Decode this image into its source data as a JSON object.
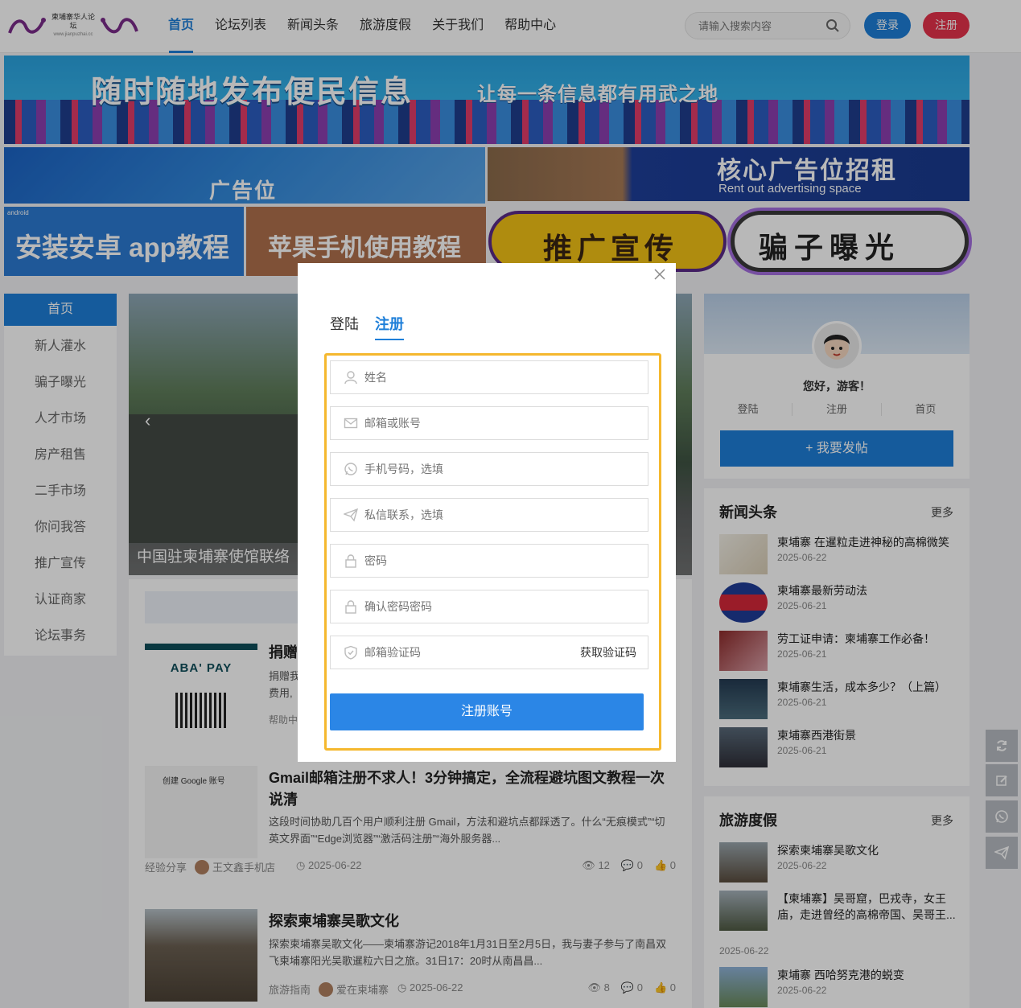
{
  "header": {
    "logo_text": "柬埔寨华人论坛",
    "logo_url": "www.jianpuzhai.cc",
    "nav": [
      "首页",
      "论坛列表",
      "新闻头条",
      "旅游度假",
      "关于我们",
      "帮助中心"
    ],
    "search_placeholder": "请输入搜索内容",
    "login": "登录",
    "register": "注册"
  },
  "banners": {
    "main_title": "随时随地发布便民信息",
    "main_sub": "让每一条信息都有用武之地",
    "ad1": "广告位",
    "ad2_title": "核心广告位招租",
    "ad2_sub": "Rent out advertising space",
    "small": [
      "安装安卓 app教程",
      "苹果手机使用教程",
      "推广宣传",
      "骗子曝光"
    ],
    "android_tag": "android"
  },
  "sidebar": {
    "items": [
      "首页",
      "新人灌水",
      "骗子曝光",
      "人才市场",
      "房产租售",
      "二手市场",
      "你问我答",
      "推广宣传",
      "认证商家",
      "论坛事务"
    ]
  },
  "slider": {
    "caption": "中国驻柬埔寨使馆联络"
  },
  "articles": [
    {
      "title": "捐赠",
      "desc": "捐赠我\n费用,",
      "category": "帮助中",
      "thumb_brand": "ABA' PAY"
    },
    {
      "title": "Gmail邮箱注册不求人！3分钟搞定，全流程避坑图文教程一次说清",
      "desc": "这段时间协助几百个用户顺利注册 Gmail，方法和避坑点都踩透了。什么“无痕模式”“切英文界面”“Edge浏览器”“激活码注册”“海外服务器...",
      "category": "经验分享",
      "author": "王文鑫手机店",
      "date": "2025-06-22",
      "views": "12",
      "comments": "0",
      "likes": "0",
      "thumb_text": "创建 Google 账号"
    },
    {
      "title": "探索柬埔寨吴歌文化",
      "desc": "探索柬埔寨吴歌文化——柬埔寨游记2018年1月31日至2月5日，我与妻子参与了南昌双飞柬埔寨阳光吴歌暹粒六日之旅。31日17：20时从南昌昌...",
      "category": "旅游指南",
      "author": "爱在柬埔寨",
      "date": "2025-06-22",
      "views": "8",
      "comments": "0",
      "likes": "0"
    }
  ],
  "userbox": {
    "greeting": "您好，游客！",
    "links": [
      "登陆",
      "注册",
      "首页"
    ],
    "post_button": "+ 我要发帖"
  },
  "news_panel": {
    "title": "新闻头条",
    "more": "更多",
    "items": [
      {
        "title": "柬埔寨 在暹粒走进神秘的高棉微笑",
        "date": "2025-06-22"
      },
      {
        "title": "柬埔寨最新劳动法",
        "date": "2025-06-21"
      },
      {
        "title": "劳工证申请：柬埔寨工作必备！",
        "date": "2025-06-21"
      },
      {
        "title": "柬埔寨生活，成本多少？（上篇）",
        "date": "2025-06-21"
      },
      {
        "title": "柬埔寨西港街景",
        "date": "2025-06-21"
      }
    ]
  },
  "travel_panel": {
    "title": "旅游度假",
    "more": "更多",
    "items": [
      {
        "title": "探索柬埔寨吴歌文化",
        "date": "2025-06-22"
      },
      {
        "title": "【柬埔寨】吴哥窟，巴戎寺，女王庙，走进曾经的高棉帝国、吴哥王...",
        "date": "2025-06-22"
      },
      {
        "title": "柬埔寨 西哈努克港的蜕变",
        "date": "2025-06-22"
      }
    ]
  },
  "modal": {
    "tab_login": "登陆",
    "tab_register": "注册",
    "fields": {
      "name": "姓名",
      "email": "邮箱或账号",
      "phone": "手机号码，选填",
      "message": "私信联系，选填",
      "password": "密码",
      "confirm": "确认密码密码",
      "code": "邮箱验证码"
    },
    "get_code": "获取验证码",
    "submit": "注册账号"
  },
  "colors": {
    "primary": "#1e7fd9",
    "danger": "#e7334b",
    "highlight": "#f5b82e"
  }
}
